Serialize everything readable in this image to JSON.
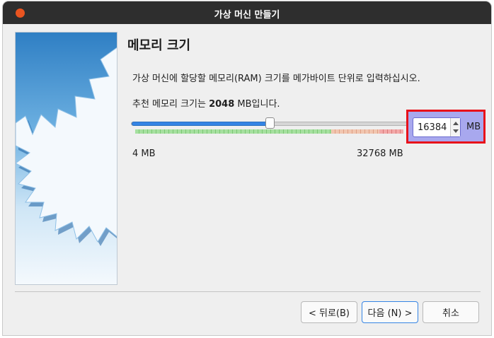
{
  "window": {
    "title": "가상 머신 만들기"
  },
  "page": {
    "heading": "메모리 크기",
    "description": "가상 머신에 할당할 메모리(RAM) 크기를 메가바이트 단위로 입력하십시오.",
    "recommend_prefix": "추천 메모리 크기는 ",
    "recommend_value": "2048",
    "recommend_suffix": " MB입니다."
  },
  "memory": {
    "slider_min_label": "4 MB",
    "slider_max_label": "32768 MB",
    "slider_min": 4,
    "slider_max": 32768,
    "value": 16384,
    "value_text": "16384",
    "unit": "MB",
    "green_fraction": 0.73,
    "orange_fraction": 0.18,
    "red_fraction": 0.09
  },
  "buttons": {
    "back": "< 뒤로(B)",
    "next": "다음 (N) >",
    "cancel": "취소"
  },
  "colors": {
    "title_bar": "#2e2e2e",
    "close_button": "#e95420",
    "accent": "#3584e4",
    "highlight_border": "#e8111a",
    "highlight_fill": "#a8a8ee"
  },
  "icons": {
    "close": "close-icon",
    "spin_up": "chevron-up-icon",
    "spin_down": "chevron-down-icon"
  }
}
